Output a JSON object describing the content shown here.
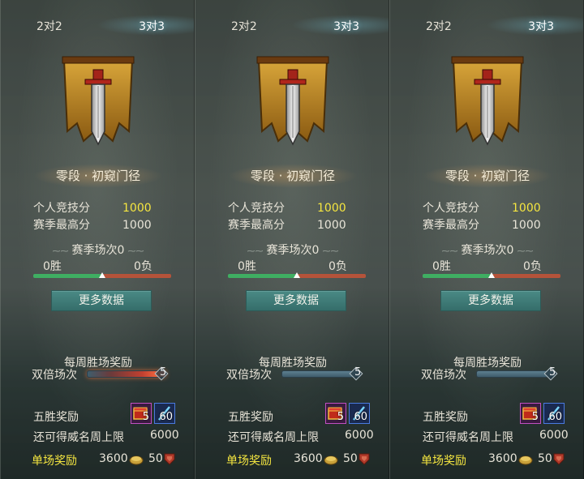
{
  "panels": [
    {
      "tabs": [
        "2对2",
        "3对3"
      ],
      "active_tab": "3对3",
      "rank_title": "零段 · 初窥门径",
      "personal_score_label": "个人竞技分",
      "personal_score": "1000",
      "season_high_label": "赛季最高分",
      "season_high": "1000",
      "season_matches": "赛季场次0",
      "wins": "0胜",
      "losses": "0负",
      "win_ratio": 0.5,
      "more_data_button": "更多数据",
      "weekly_reward_title": "每周胜场奖励",
      "double_label": "双倍场次",
      "double_count": "5",
      "double_bar_hot": true,
      "five_win_label": "五胜奖励",
      "item1_count": "5",
      "item2_count": "60",
      "remaining_label": "还可得威名周上限",
      "remaining_value": "6000",
      "single_reward_label": "单场奖励",
      "coins": "3600",
      "fame": "50"
    },
    {
      "tabs": [
        "2对2",
        "3对3"
      ],
      "active_tab": "3对3",
      "rank_title": "零段 · 初窥门径",
      "personal_score_label": "个人竞技分",
      "personal_score": "1000",
      "season_high_label": "赛季最高分",
      "season_high": "1000",
      "season_matches": "赛季场次0",
      "wins": "0胜",
      "losses": "0负",
      "win_ratio": 0.5,
      "more_data_button": "更多数据",
      "weekly_reward_title": "每周胜场奖励",
      "double_label": "双倍场次",
      "double_count": "5",
      "double_bar_hot": false,
      "five_win_label": "五胜奖励",
      "item1_count": "5",
      "item2_count": "60",
      "remaining_label": "还可得威名周上限",
      "remaining_value": "6000",
      "single_reward_label": "单场奖励",
      "coins": "3600",
      "fame": "50"
    },
    {
      "tabs": [
        "2对2",
        "3对3"
      ],
      "active_tab": "3对3",
      "rank_title": "零段 · 初窥门径",
      "personal_score_label": "个人竞技分",
      "personal_score": "1000",
      "season_high_label": "赛季最高分",
      "season_high": "1000",
      "season_matches": "赛季场次0",
      "wins": "0胜",
      "losses": "0负",
      "win_ratio": 0.5,
      "more_data_button": "更多数据",
      "weekly_reward_title": "每周胜场奖励",
      "double_label": "双倍场次",
      "double_count": "5",
      "double_bar_hot": false,
      "five_win_label": "五胜奖励",
      "item1_count": "5",
      "item2_count": "60",
      "remaining_label": "还可得威名周上限",
      "remaining_value": "6000",
      "single_reward_label": "单场奖励",
      "coins": "3600",
      "fame": "50"
    }
  ],
  "colors": {
    "score_yellow": "#f5e640",
    "button_teal": "#3f7c78",
    "win_green": "#3fae62",
    "loss_red": "#b5533a",
    "emblem_gold": "#c99326"
  },
  "icons": {
    "emblem": "sword-banner-icon",
    "item1": "red-chest-icon",
    "item2": "blue-sword-icon",
    "coin": "coin-icon",
    "fame": "shield-badge-icon"
  }
}
